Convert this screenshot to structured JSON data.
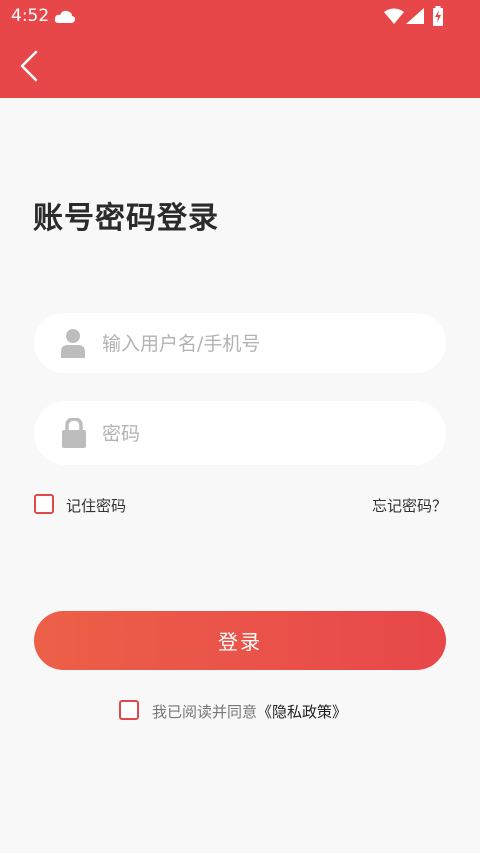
{
  "status_bar": {
    "time": "4:52"
  },
  "header": {
    "back_icon": "chevron-left-icon",
    "background_color": "#e8474a"
  },
  "page": {
    "title": "账号密码登录"
  },
  "form": {
    "username": {
      "icon": "user-icon",
      "placeholder": "输入用户名/手机号",
      "value": ""
    },
    "password": {
      "icon": "lock-icon",
      "placeholder": "密码",
      "value": ""
    },
    "remember_label": "记住密码",
    "remember_checked": false,
    "forgot_label": "忘记密码？",
    "login_label": "登录"
  },
  "agreement": {
    "text": "我已阅读并同意",
    "policy_link": "《隐私政策》",
    "checked": false
  },
  "colors": {
    "accent": "#e8474a",
    "button_gradient_start": "#ec6048",
    "page_background": "#f8f8f8"
  }
}
